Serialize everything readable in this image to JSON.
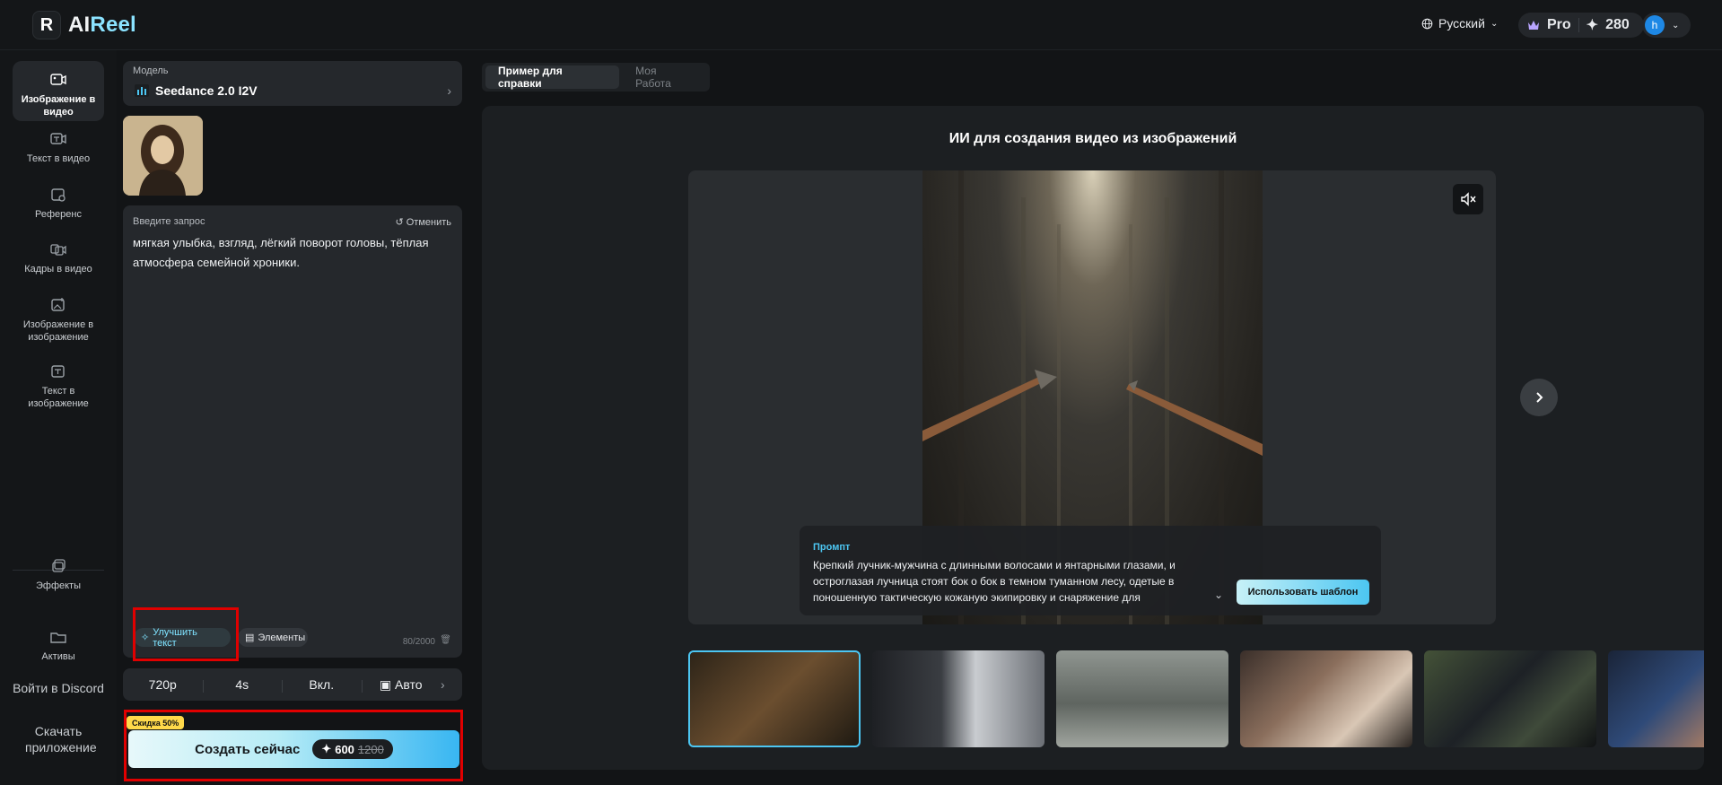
{
  "header": {
    "logo_letter": "R",
    "logo_text_main": "AI",
    "logo_text_accent": "Reel",
    "language": "Русский",
    "plan": "Pro",
    "credits": "280",
    "avatar_letter": "h"
  },
  "sidebar": {
    "items": [
      {
        "label": "Изображение в видео",
        "icon": "image-to-video-icon"
      },
      {
        "label": "Текст в видео",
        "icon": "text-to-video-icon"
      },
      {
        "label": "Референс",
        "icon": "reference-icon"
      },
      {
        "label": "Кадры в видео",
        "icon": "frames-to-video-icon"
      },
      {
        "label": "Изображение в изображение",
        "icon": "image-to-image-icon"
      },
      {
        "label": "Текст в изображение",
        "icon": "text-to-image-icon"
      },
      {
        "label": "Эффекты",
        "icon": "effects-icon"
      },
      {
        "label": "Активы",
        "icon": "assets-icon"
      }
    ],
    "discord": "Войти в Discord",
    "download": "Скачать приложение"
  },
  "model": {
    "label": "Модель",
    "name": "Seedance 2.0 I2V"
  },
  "prompt": {
    "label": "Введите запрос",
    "undo": "Отменить",
    "text": "мягкая улыбка, взгляд, лёгкий поворот головы, тёплая атмосфера семейной хроники.",
    "enhance": "Улучшить текст",
    "elements": "Элементы",
    "counter": "80/2000"
  },
  "settings": {
    "resolution": "720p",
    "duration": "4s",
    "audio": "Вкл.",
    "ratio": "Авто"
  },
  "create": {
    "discount": "Скидка 50%",
    "label": "Создать сейчас",
    "cost": "600",
    "old_cost": "1200"
  },
  "tabs": [
    "Пример для справки",
    "Моя Работа"
  ],
  "showcase": {
    "title": "ИИ для создания видео из изображений",
    "prompt_label": "Промпт",
    "prompt_text": "Крепкий лучник-мужчина с длинными волосами и янтарными глазами, и остроглазая лучница стоят бок о бок в темном туманном лесу, одетые в поношенную тактическую кожаную экипировку и снаряжение для",
    "use_template": "Использовать шаблон"
  },
  "colors": {
    "accent": "#4cc6f2",
    "highlight": "#e00000",
    "discount": "#ffd94a"
  }
}
